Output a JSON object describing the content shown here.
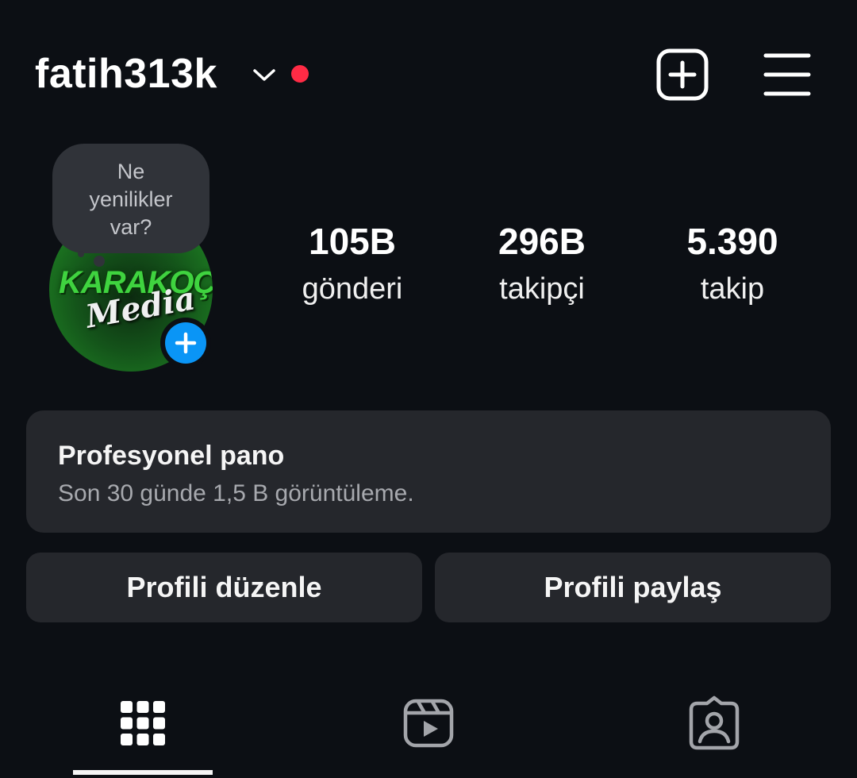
{
  "header": {
    "username": "fatih313k",
    "icons": [
      "chevron-down-icon",
      "notification-dot",
      "new-post-icon",
      "menu-icon"
    ],
    "notification_color": "#ff2b45"
  },
  "profile": {
    "avatar_logo_top": "KARAKOÇ",
    "avatar_logo_bottom": "Media",
    "note_lines": [
      "Ne",
      "yenilikler",
      "var?"
    ],
    "add_story_color": "#0a95f6"
  },
  "stats": [
    {
      "value": "105B",
      "label": "gönderi"
    },
    {
      "value": "296B",
      "label": "takipçi"
    },
    {
      "value": "5.390",
      "label": "takip"
    }
  ],
  "dashboard": {
    "title": "Profesyonel pano",
    "subtitle": "Son 30 günde 1,5 B görüntüleme."
  },
  "buttons": {
    "edit": "Profili düzenle",
    "share": "Profili paylaş"
  },
  "tabs": [
    {
      "icon": "grid-icon",
      "active": true
    },
    {
      "icon": "reels-icon",
      "active": false
    },
    {
      "icon": "tagged-icon",
      "active": false
    }
  ]
}
